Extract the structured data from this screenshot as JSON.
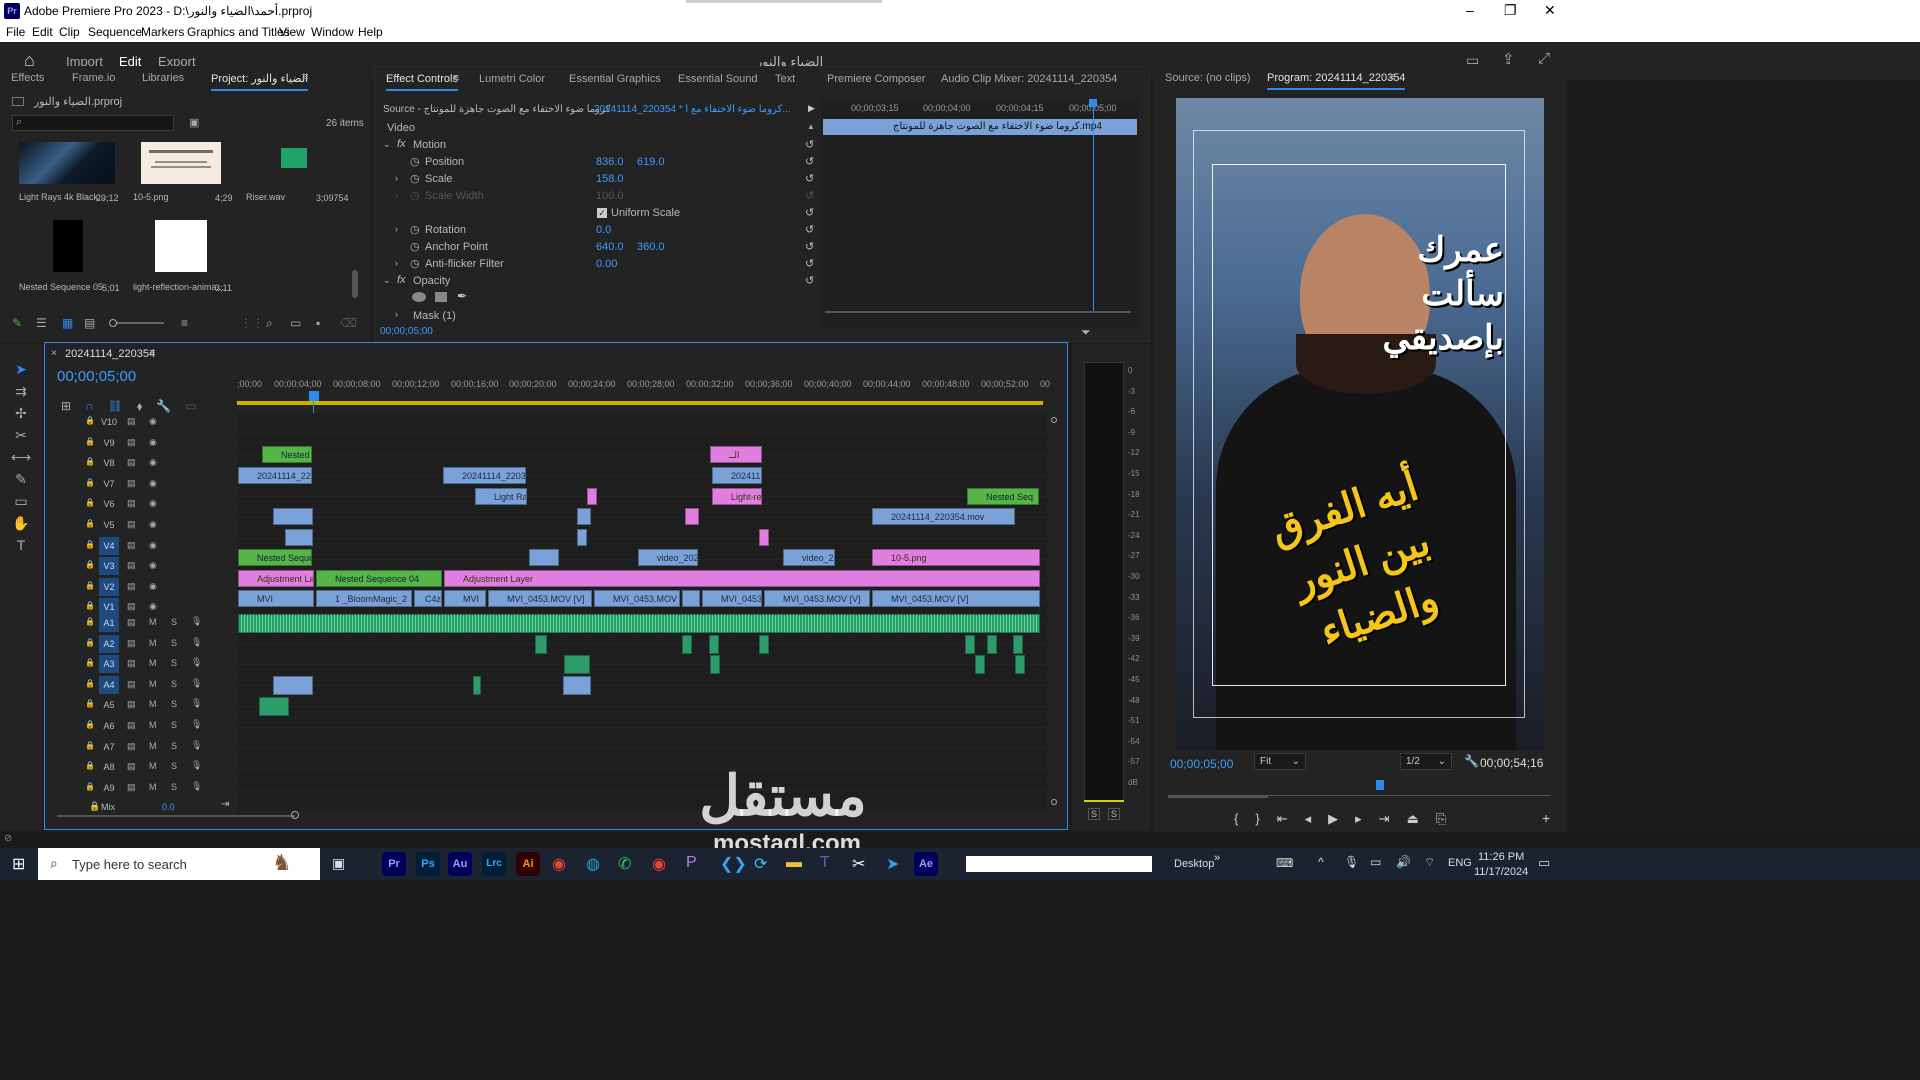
{
  "window": {
    "title": "Adobe Premiere Pro 2023 - D:\\أحمد\\الضياء والنور.prproj",
    "app_icon": "Pr"
  },
  "menu": [
    "File",
    "Edit",
    "Clip",
    "Sequence",
    "Markers",
    "Graphics and Titles",
    "View",
    "Window",
    "Help"
  ],
  "workspace": {
    "tabs": [
      "Import",
      "Edit",
      "Export"
    ],
    "active": "Edit",
    "project_title": "الضياء والنور"
  },
  "project_panel": {
    "tabs": [
      "Effects",
      "Frame.io",
      "Libraries",
      "Project: الضياء والنور"
    ],
    "file": "الضياء والنور.prproj",
    "items_count": "26 items",
    "search_placeholder": "",
    "items": [
      {
        "name": "Light Rays 4k Black...",
        "dur": "29;12"
      },
      {
        "name": "10-5.png",
        "dur": "4;29"
      },
      {
        "name": "Riser.wav",
        "dur": "3;09754"
      },
      {
        "name": "Nested Sequence 05",
        "dur": "5;01"
      },
      {
        "name": "light-reflection-anima...",
        "dur": "3;11"
      }
    ]
  },
  "effect_controls": {
    "tabs": [
      "Effect Controls",
      "Lumetri Color",
      "Essential Graphics",
      "Essential Sound",
      "Text",
      "Premiere Composer",
      "Audio Clip Mixer: 20241114_220354"
    ],
    "source": "Source - كروما ضوء الاختفاء مع الصوت جاهزة للمونتاج",
    "seq": "20241114_220354 * كروما ضوء الاختفاء مع ا...",
    "clip_bar": "كروما ضوء الاختفاء مع الصوت جاهزة للمونتاج.mp4",
    "ruler": [
      "00;00;03;15",
      "00;00;04;00",
      "00;00;04;15",
      "00;00;05;00"
    ],
    "section": "Video",
    "props": [
      {
        "name": "Motion",
        "v1": "",
        "v2": ""
      },
      {
        "name": "Position",
        "v1": "836.0",
        "v2": "619.0"
      },
      {
        "name": "Scale",
        "v1": "158.0",
        "v2": ""
      },
      {
        "name": "Scale Width",
        "v1": "100.0",
        "v2": ""
      },
      {
        "name": "Uniform Scale",
        "v1": "",
        "v2": ""
      },
      {
        "name": "Rotation",
        "v1": "0.0",
        "v2": ""
      },
      {
        "name": "Anchor Point",
        "v1": "640.0",
        "v2": "360.0"
      },
      {
        "name": "Anti-flicker Filter",
        "v1": "0.00",
        "v2": ""
      },
      {
        "name": "Opacity",
        "v1": "",
        "v2": ""
      },
      {
        "name": "Mask (1)",
        "v1": "",
        "v2": ""
      }
    ],
    "timecode": "00;00;05;00"
  },
  "program_monitor": {
    "tabs": [
      "Source: (no clips)",
      "Program: 20241114_220354"
    ],
    "timecode": "00;00;05;00",
    "fit": "Fit",
    "quality": "1/2",
    "duration": "00;00;54;16",
    "overlay_top": [
      "عمرك",
      "سألت",
      "بإصديقي"
    ],
    "overlay_bottom": [
      "أيه الفرق",
      "بين النور",
      "والضياء"
    ]
  },
  "timeline": {
    "sequence": "20241114_220354",
    "timecode": "00;00;05;00",
    "ruler": [
      ";00;00",
      "00;00;04;00",
      "00;00;08;00",
      "00;00;12;00",
      "00;00;16;00",
      "00;00;20;00",
      "00;00;24;00",
      "00;00;28;00",
      "00;00;32;00",
      "00;00;36;00",
      "00;00;40;00",
      "00;00;44;00",
      "00;00;48;00",
      "00;00;52;00",
      "00"
    ],
    "video_tracks": [
      "V10",
      "V9",
      "V8",
      "V7",
      "V6",
      "V5",
      "V4",
      "V3",
      "V2",
      "V1"
    ],
    "audio_tracks": [
      "A1",
      "A2",
      "A3",
      "A4",
      "A5",
      "A6",
      "A7",
      "A8",
      "A9"
    ],
    "mix": {
      "label": "Mix",
      "value": "0.0"
    },
    "clips": {
      "nested": "Nested",
      "c1": "20241114_220",
      "c2": "20241114_22035",
      "c3": "Light Ra",
      "c4": "202411",
      "c5": "Light-re",
      "c6": "Nested Seq",
      "c7": "20241114_220354.mov",
      "c8": "Nested Sequer",
      "c9": "video_202",
      "c10": "video_2",
      "c11": "10-5.png",
      "c12": "Adjustment Lay",
      "c13": "Nested Sequence 04",
      "c14": "Adjustment Layer",
      "c15": "MVI",
      "c16": "1 _BloomMagic_2",
      "c17": "C4z",
      "c18": "MVI",
      "c19": "MVI_0453.MOV [V]",
      "c20": "MVI_0453.MOV",
      "c21": "MVI_0453.",
      "c22": "MVI_0453.MOV [V]",
      "c23": "MVI_0453.MOV [V]",
      "c24": "الــ"
    }
  },
  "meters": [
    "0",
    "-3",
    "-6",
    "-9",
    "-12",
    "-15",
    "-18",
    "-21",
    "-24",
    "-27",
    "-30",
    "-33",
    "-36",
    "-39",
    "-42",
    "-45",
    "-48",
    "-51",
    "-54",
    "-57",
    "dB"
  ],
  "meter_buttons": [
    "S",
    "S"
  ],
  "taskbar": {
    "search_placeholder": "Type here to search",
    "apps": [
      "Pr",
      "Ps",
      "Au",
      "Lrc",
      "Ai",
      "Ae"
    ],
    "desktop": "Desktop",
    "lang": "ENG",
    "time": "11:26 PM",
    "date": "11/17/2024"
  },
  "watermark": {
    "ar": "مستقل",
    "en": "mostaql.com"
  },
  "colors": {
    "accent": "#2d8ceb",
    "video_clip": "#7aa2d8",
    "green_clip": "#55b547",
    "pink_clip": "#e07fe0",
    "audio_clip": "#2e9b6a",
    "overlay_text": "#f5c518"
  }
}
